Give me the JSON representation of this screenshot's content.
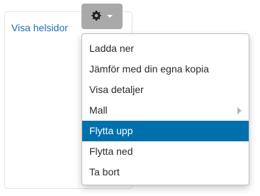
{
  "page": {
    "view_link_label": "Visa helsidor"
  },
  "actions_button": {
    "icon": "gear-icon",
    "caret": "caret-down-icon",
    "background": "#a9a9a9"
  },
  "menu": {
    "items": [
      {
        "label": "Ladda ner"
      },
      {
        "label": "Jämför med din egna kopia"
      },
      {
        "label": "Visa detaljer"
      },
      {
        "label": "Mall",
        "has_submenu": true
      },
      {
        "label": "Flytta upp",
        "active": true
      },
      {
        "label": "Flytta ned"
      },
      {
        "label": "Ta bort"
      }
    ],
    "active_color": "#0070ad"
  },
  "colors": {
    "link": "#1f6fb3"
  }
}
